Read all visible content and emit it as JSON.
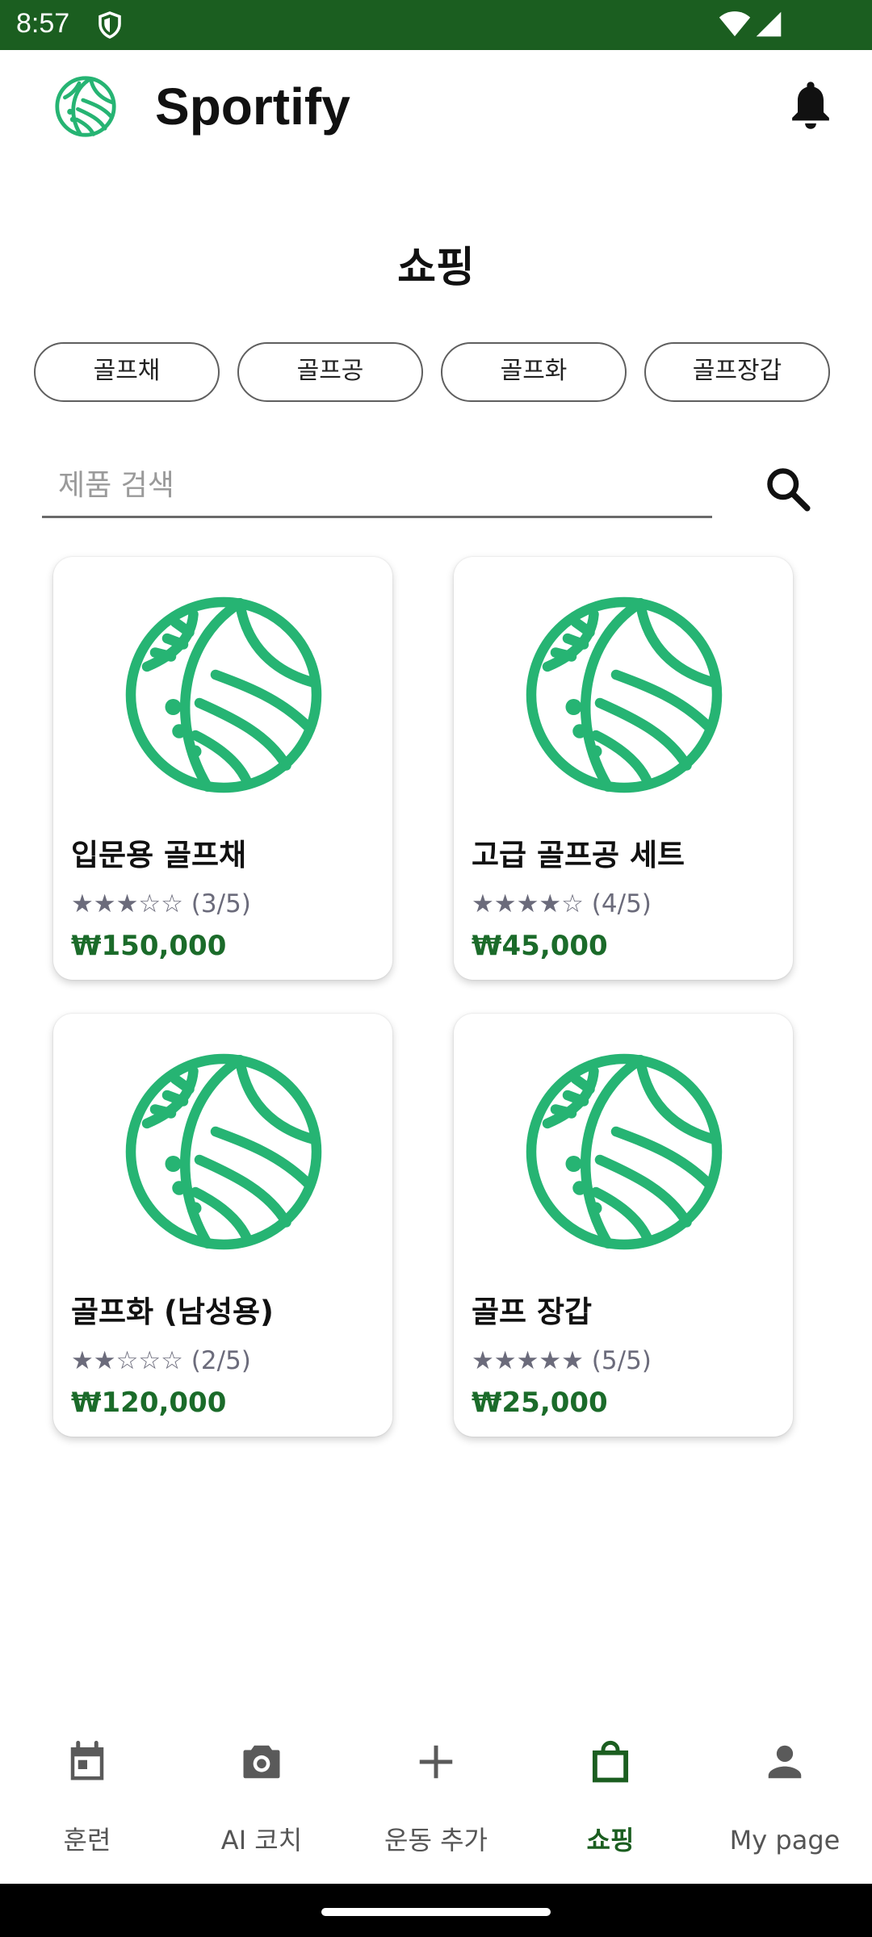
{
  "status_bar": {
    "time": "8:57"
  },
  "app": {
    "title": "Sportify"
  },
  "page": {
    "title": "쇼핑"
  },
  "categories": [
    "골프채",
    "골프공",
    "골프화",
    "골프장갑"
  ],
  "search": {
    "placeholder": "제품 검색"
  },
  "products": [
    {
      "name": "입문용 골프채",
      "rating_text": "★★★☆☆ (3/5)",
      "rating": 3,
      "price": "₩150,000",
      "icon": "sports-ball-icon"
    },
    {
      "name": "고급 골프공 세트",
      "rating_text": "★★★★☆ (4/5)",
      "rating": 4,
      "price": "₩45,000",
      "icon": "sports-ball-icon"
    },
    {
      "name": "골프화 (남성용)",
      "rating_text": "★★☆☆☆ (2/5)",
      "rating": 2,
      "price": "₩120,000",
      "icon": "sports-ball-icon"
    },
    {
      "name": "골프 장갑",
      "rating_text": "★★★★★ (5/5)",
      "rating": 5,
      "price": "₩25,000",
      "icon": "sports-ball-icon"
    }
  ],
  "bottom_nav": [
    {
      "label": "훈련",
      "icon": "calendar-icon",
      "active": false
    },
    {
      "label": "AI 코치",
      "icon": "camera-icon",
      "active": false
    },
    {
      "label": "운동 추가",
      "icon": "plus-icon",
      "active": false
    },
    {
      "label": "쇼핑",
      "icon": "shopping-bag-icon",
      "active": true
    },
    {
      "label": "My page",
      "icon": "person-icon",
      "active": false
    }
  ],
  "colors": {
    "status_bar": "#1b5e20",
    "accent": "#26b473",
    "price": "#1b6b2a",
    "active_nav": "#1b5e20"
  }
}
